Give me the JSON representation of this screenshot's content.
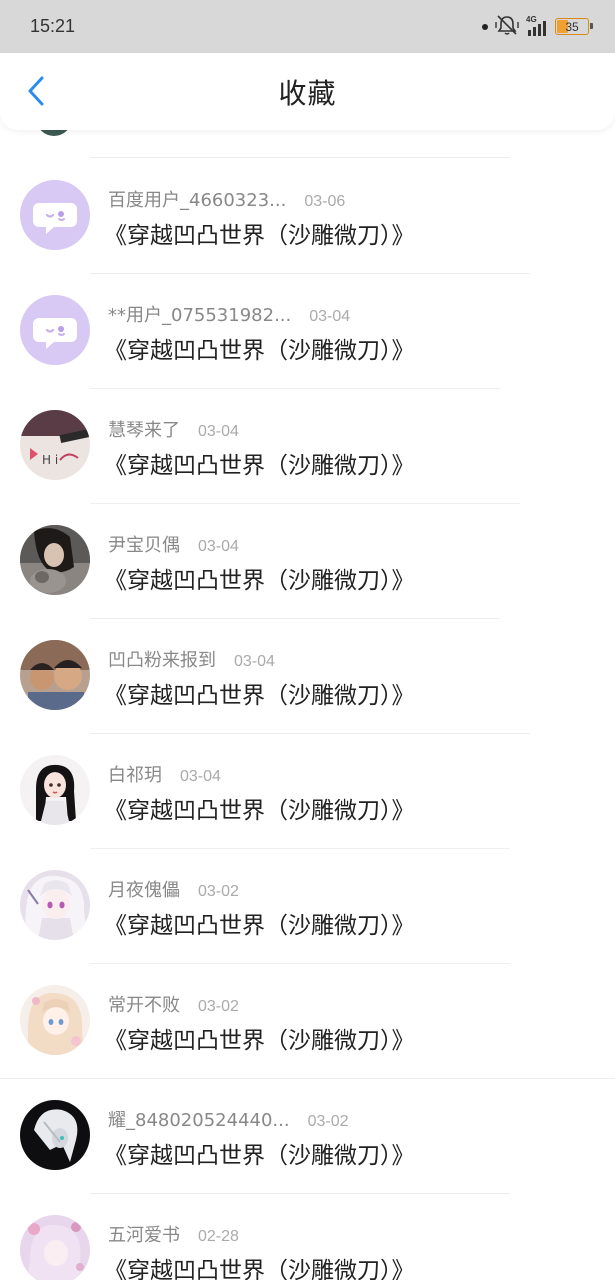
{
  "status_bar": {
    "time": "15:21",
    "battery": "35",
    "network": "4G"
  },
  "header": {
    "title": "收藏"
  },
  "items": [
    {
      "user": "百度用户_4660323...",
      "date": "03-06",
      "title": "《穿越凹凸世界（沙雕微刀）》",
      "avatar": "default-chat-bubble"
    },
    {
      "user": "**用户_075531982...",
      "date": "03-04",
      "title": "《穿越凹凸世界（沙雕微刀）》",
      "avatar": "default-chat-bubble"
    },
    {
      "user": "慧琴来了",
      "date": "03-04",
      "title": "《穿越凹凸世界（沙雕微刀）》",
      "avatar": "photo"
    },
    {
      "user": "尹宝贝偶",
      "date": "03-04",
      "title": "《穿越凹凸世界（沙雕微刀）》",
      "avatar": "photo"
    },
    {
      "user": "凹凸粉来报到",
      "date": "03-04",
      "title": "《穿越凹凸世界（沙雕微刀）》",
      "avatar": "photo"
    },
    {
      "user": "白祁玥",
      "date": "03-04",
      "title": "《穿越凹凸世界（沙雕微刀）》",
      "avatar": "photo"
    },
    {
      "user": "月夜傀儡",
      "date": "03-02",
      "title": "《穿越凹凸世界（沙雕微刀）》",
      "avatar": "photo"
    },
    {
      "user": "常开不败",
      "date": "03-02",
      "title": "《穿越凹凸世界（沙雕微刀）》",
      "avatar": "photo"
    },
    {
      "user": "耀_848020524440...",
      "date": "03-02",
      "title": "《穿越凹凸世界（沙雕微刀）》",
      "avatar": "photo"
    },
    {
      "user": "五河爱书",
      "date": "02-28",
      "title": "《穿越凹凸世界（沙雕微刀）》",
      "avatar": "photo"
    }
  ],
  "colors": {
    "accent": "#2a8cf0",
    "default_avatar": "#d8c8f4",
    "status_bar": "#d8d8d8"
  }
}
